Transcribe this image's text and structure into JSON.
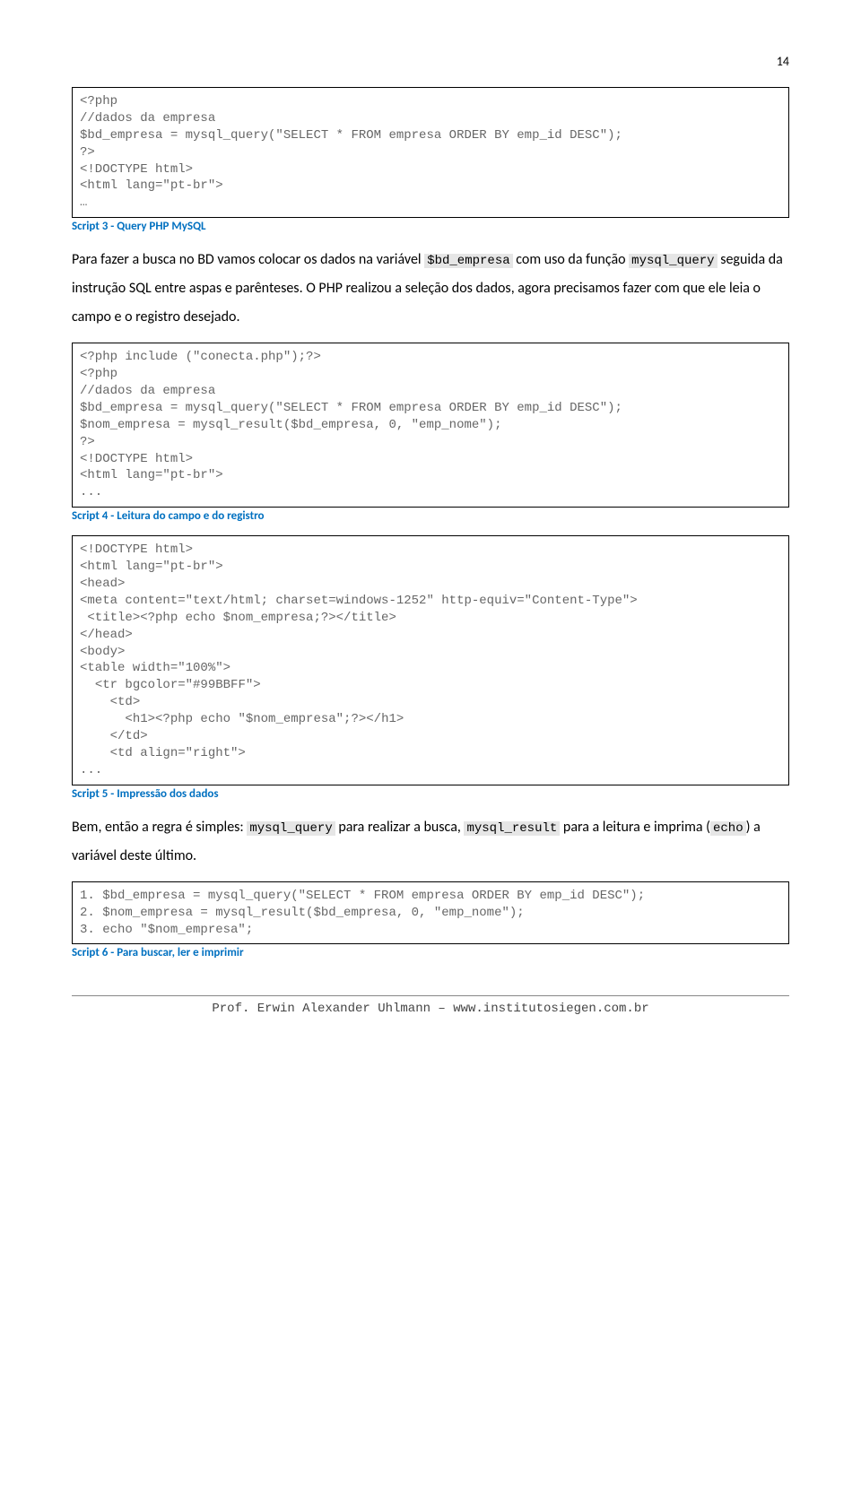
{
  "page_number": "14",
  "code1": "<?php\n//dados da empresa\n$bd_empresa = mysql_query(\"SELECT * FROM empresa ORDER BY emp_id DESC\");\n?>\n<!DOCTYPE html>\n<html lang=\"pt-br\">\n…",
  "caption1": "Script 3 - Query PHP MySQL",
  "para1_before": "Para fazer a busca no BD vamos colocar os dados na variável ",
  "para1_inline1": "$bd_empresa",
  "para1_mid": " com uso da função ",
  "para1_inline2": "mysql_query",
  "para1_after": " seguida da instrução SQL entre aspas e parênteses. O PHP realizou a seleção dos dados, agora precisamos fazer com que ele leia o campo e o registro desejado.",
  "code2": "<?php include (\"conecta.php\");?>\n<?php\n//dados da empresa\n$bd_empresa = mysql_query(\"SELECT * FROM empresa ORDER BY emp_id DESC\");\n$nom_empresa = mysql_result($bd_empresa, 0, \"emp_nome\");\n?>\n<!DOCTYPE html>\n<html lang=\"pt-br\">\n...",
  "caption2": "Script 4 - Leitura do campo e do registro",
  "code3": "<!DOCTYPE html>\n<html lang=\"pt-br\">\n<head>\n<meta content=\"text/html; charset=windows-1252\" http-equiv=\"Content-Type\">\n <title><?php echo $nom_empresa;?></title>\n</head>\n<body>\n<table width=\"100%\">\n  <tr bgcolor=\"#99BBFF\">\n    <td>\n      <h1><?php echo \"$nom_empresa\";?></h1>\n    </td>\n    <td align=\"right\">\n...",
  "caption3": "Script 5 - Impressão dos dados",
  "para2_before": "Bem, então a regra é simples: ",
  "para2_inline1": "mysql_query",
  "para2_mid1": " para realizar a busca, ",
  "para2_inline2": "mysql_result",
  "para2_mid2": " para a leitura e imprima (",
  "para2_inline3": "echo",
  "para2_after": ") a variável deste último.",
  "code4": "1. $bd_empresa = mysql_query(\"SELECT * FROM empresa ORDER BY emp_id DESC\");\n2. $nom_empresa = mysql_result($bd_empresa, 0, \"emp_nome\");\n3. echo \"$nom_empresa\";",
  "caption4": "Script 6 - Para buscar, ler e imprimir",
  "footer": "Prof. Erwin Alexander Uhlmann – www.institutosiegen.com.br"
}
